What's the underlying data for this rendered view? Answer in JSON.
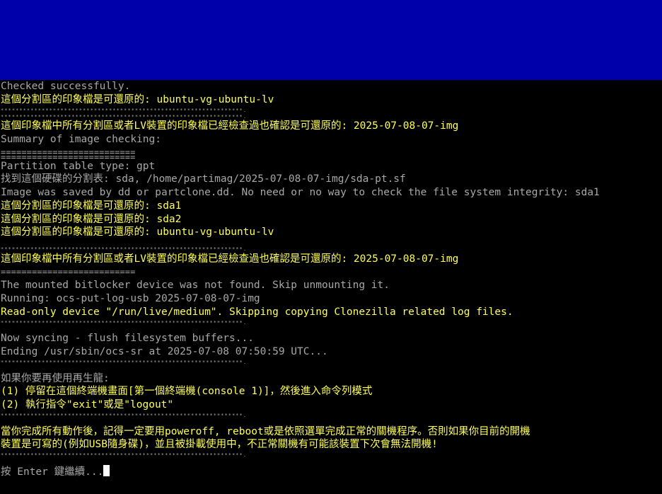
{
  "colors": {
    "top_band": "#0000aa",
    "background": "#000000",
    "normal_text": "#a8a8a8",
    "highlight_text": "#ffff54",
    "cursor": "#ffffff"
  },
  "console": {
    "l01": "Checked successfully.",
    "l02": "這個分割區的印象檔是可還原的: ubuntu-vg-ubuntu-lv",
    "l03a": "*****************************************************************.",
    "l03b": "*****************************************************************.",
    "l04": "這個印象檔中所有分割區或者LV裝置的印象檔已經檢查過也確認是可還原的: 2025-07-08-07-img",
    "l05": "Summary of image checking:",
    "l06a": "==========================",
    "l06b": "==========================",
    "l07": "Partition table type: gpt",
    "l08": "找到這個硬碟的分割表: sda, /home/partimag/2025-07-08-07-img/sda-pt.sf",
    "l09": "Image was saved by dd or partclone.dd. No need or no way to check the file system integrity: sda1",
    "l10": "這個分割區的印象檔是可還原的: sda1",
    "l11": "這個分割區的印象檔是可還原的: sda2",
    "l12": "這個分割區的印象檔是可還原的: ubuntu-vg-ubuntu-lv",
    "l13": "*****************************************************************.",
    "l14": "這個印象檔中所有分割區或者LV裝置的印象檔已經檢查過也確認是可還原的: 2025-07-08-07-img",
    "l15": "==========================",
    "l16": "The mounted bitlocker device was not found. Skip unmounting it.",
    "l17": "Running: ocs-put-log-usb 2025-07-08-07-img",
    "l18": "Read-only device \"/run/live/medium\". Skipping copying Clonezilla related log files.",
    "l19": "*****************************************************************.",
    "l20": "Now syncing - flush filesystem buffers...",
    "l21": "Ending /usr/sbin/ocs-sr at 2025-07-08 07:50:59 UTC...",
    "l22": "*****************************************************************.",
    "l23": "如果你要再使用再生龍:",
    "l24": "(1) 停留在這個終端機畫面[第一個終端機(console 1)]，然後進入命令列模式",
    "l25": "(2) 執行指令\"exit\"或是\"logout\"",
    "l26": "*****************************************************************.",
    "l27": "當你完成所有動作後，記得一定要用poweroff, reboot或是依照選單完成正常的關機程序。否則如果你目前的開機",
    "l28": "裝置是可寫的(例如USB隨身碟)，並且被掛載使用中，不正常關機有可能該裝置下次會無法開機!",
    "l29": "*****************************************************************.",
    "l30": "按 Enter 鍵繼續..."
  }
}
